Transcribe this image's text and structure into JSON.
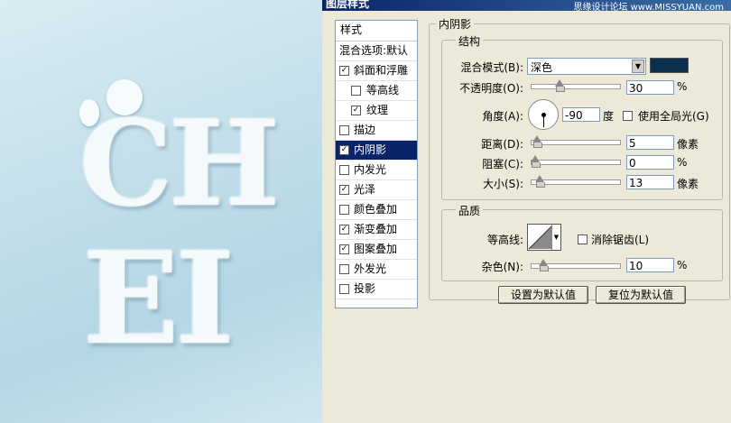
{
  "window": {
    "title": "图层样式",
    "watermark": "思缘设计论坛  www.MISSYUAN.com"
  },
  "preview": {
    "line1": "CH",
    "line2": "EI"
  },
  "styles_list": {
    "header": "样式",
    "blend_options": "混合选项:默认",
    "items": [
      {
        "label": "斜面和浮雕",
        "checked": true,
        "indent": false,
        "selected": false
      },
      {
        "label": "等高线",
        "checked": false,
        "indent": true,
        "selected": false
      },
      {
        "label": "纹理",
        "checked": true,
        "indent": true,
        "selected": false
      },
      {
        "label": "描边",
        "checked": false,
        "indent": false,
        "selected": false
      },
      {
        "label": "内阴影",
        "checked": true,
        "indent": false,
        "selected": true
      },
      {
        "label": "内发光",
        "checked": false,
        "indent": false,
        "selected": false
      },
      {
        "label": "光泽",
        "checked": true,
        "indent": false,
        "selected": false
      },
      {
        "label": "颜色叠加",
        "checked": false,
        "indent": false,
        "selected": false
      },
      {
        "label": "渐变叠加",
        "checked": true,
        "indent": false,
        "selected": false
      },
      {
        "label": "图案叠加",
        "checked": true,
        "indent": false,
        "selected": false
      },
      {
        "label": "外发光",
        "checked": false,
        "indent": false,
        "selected": false
      },
      {
        "label": "投影",
        "checked": false,
        "indent": false,
        "selected": false
      }
    ]
  },
  "panel": {
    "title": "内阴影",
    "structure": {
      "legend": "结构",
      "blend_mode_label": "混合模式(B):",
      "blend_mode_value": "深色",
      "color_swatch": "#0b2f4f",
      "opacity_label": "不透明度(O):",
      "opacity_value": "30",
      "opacity_fraction": 0.3,
      "opacity_unit": "%",
      "angle_label": "角度(A):",
      "angle_value": "-90",
      "angle_unit": "度",
      "global_light_label": "使用全局光(G)",
      "global_light_checked": false,
      "distance_label": "距离(D):",
      "distance_value": "5",
      "distance_fraction": 0.02,
      "distance_unit": "像素",
      "choke_label": "阻塞(C):",
      "choke_value": "0",
      "choke_fraction": 0.0,
      "choke_unit": "%",
      "size_label": "大小(S):",
      "size_value": "13",
      "size_fraction": 0.06,
      "size_unit": "像素"
    },
    "quality": {
      "legend": "品质",
      "contour_label": "等高线:",
      "antialias_label": "消除锯齿(L)",
      "antialias_checked": false,
      "noise_label": "杂色(N):",
      "noise_value": "10",
      "noise_fraction": 0.1,
      "noise_unit": "%"
    },
    "buttons": {
      "set_default": "设置为默认值",
      "reset_default": "复位为默认值"
    }
  }
}
